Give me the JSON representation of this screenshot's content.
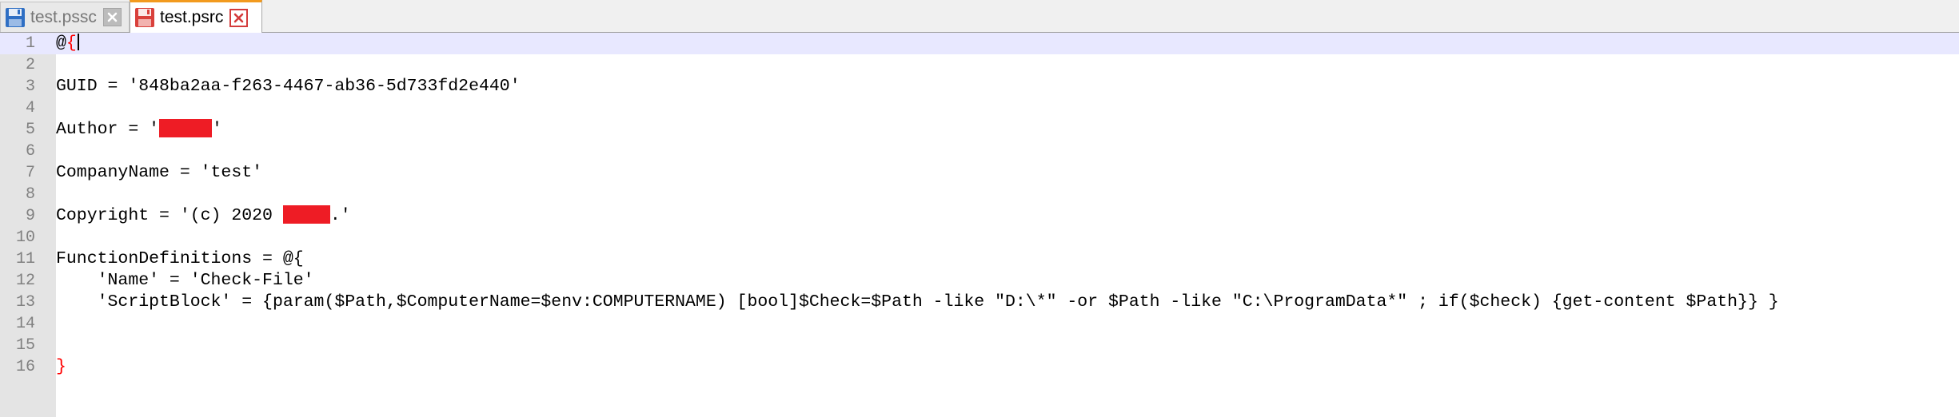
{
  "tabs": [
    {
      "label": "test.pssc",
      "active": false,
      "icon": "floppy-disk-blue-icon"
    },
    {
      "label": "test.psrc",
      "active": true,
      "icon": "floppy-disk-red-icon"
    }
  ],
  "editor": {
    "lines": [
      {
        "num": "1",
        "pre": "@",
        "brace": "{",
        "post": ""
      },
      {
        "num": "2",
        "text": ""
      },
      {
        "num": "3",
        "text": "GUID = '848ba2aa-f263-4467-ab36-5d733fd2e440'"
      },
      {
        "num": "4",
        "text": ""
      },
      {
        "num": "5",
        "pre": "Author = '",
        "post": "'"
      },
      {
        "num": "6",
        "text": ""
      },
      {
        "num": "7",
        "text": "CompanyName = 'test'"
      },
      {
        "num": "8",
        "text": ""
      },
      {
        "num": "9",
        "pre": "Copyright = '(c) 2020 ",
        "post": ".'"
      },
      {
        "num": "10",
        "text": ""
      },
      {
        "num": "11",
        "text": "FunctionDefinitions = @{"
      },
      {
        "num": "12",
        "text": "    'Name' = 'Check-File'"
      },
      {
        "num": "13",
        "text": "    'ScriptBlock' = {param($Path,$ComputerName=$env:COMPUTERNAME) [bool]$Check=$Path -like \"D:\\*\" -or $Path -like \"C:\\ProgramData*\" ; if($check) {get-content $Path}} }"
      },
      {
        "num": "14",
        "text": ""
      },
      {
        "num": "15",
        "text": ""
      },
      {
        "num": "16",
        "brace": "}"
      }
    ]
  },
  "colors": {
    "accent_tab": "#f29a1e",
    "current_line": "#e8e8ff",
    "brace_match": "#ff0000",
    "redaction": "#ee1c25"
  }
}
